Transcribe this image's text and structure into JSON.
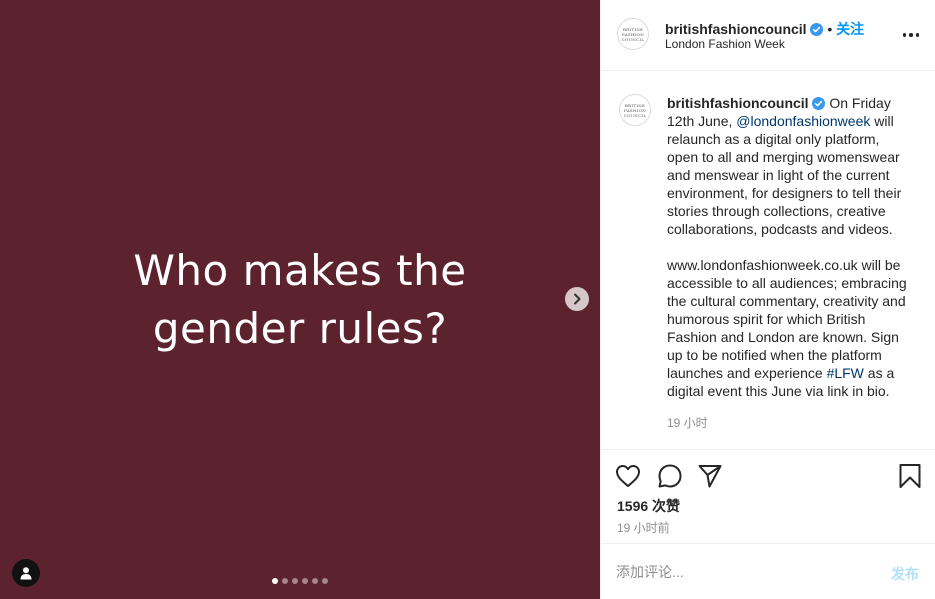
{
  "post": {
    "slide_text": "Who makes the\ngender rules?",
    "slide_count": 6,
    "current_slide": 1
  },
  "account": {
    "username": "britishfashioncouncil",
    "follow_label": "关注",
    "separator": "•",
    "location": "London Fashion Week",
    "avatar_lines": [
      "BRITISH",
      "FASHION",
      "COUNCIL"
    ]
  },
  "caption": {
    "username": "britishfashioncouncil",
    "text_part1": "On Friday 12th June, ",
    "mention": "@londonfashionweek",
    "text_part2": " will relaunch as a digital only platform, open to all and merging womenswear and menswear in light of the current environment, for designers to tell their stories through collections, creative collaborations, podcasts and videos.",
    "para2_part1": "www.londonfashionweek.co.uk will be accessible to all audiences; embracing the cultural commentary, creativity and humorous spirit for which British Fashion and London are known. Sign up to be notified when the platform launches and experience ",
    "hashtag": "#LFW",
    "para2_part2": " as a digital event this June via link in bio.",
    "time": "19 小时"
  },
  "engagement": {
    "likes": "1596 次赞",
    "time": "19 小时前"
  },
  "comment": {
    "placeholder": "添加评论...",
    "post_label": "发布"
  },
  "colors": {
    "slide_background": "#5c232e",
    "link": "#00376b",
    "accent": "#0095f6"
  }
}
